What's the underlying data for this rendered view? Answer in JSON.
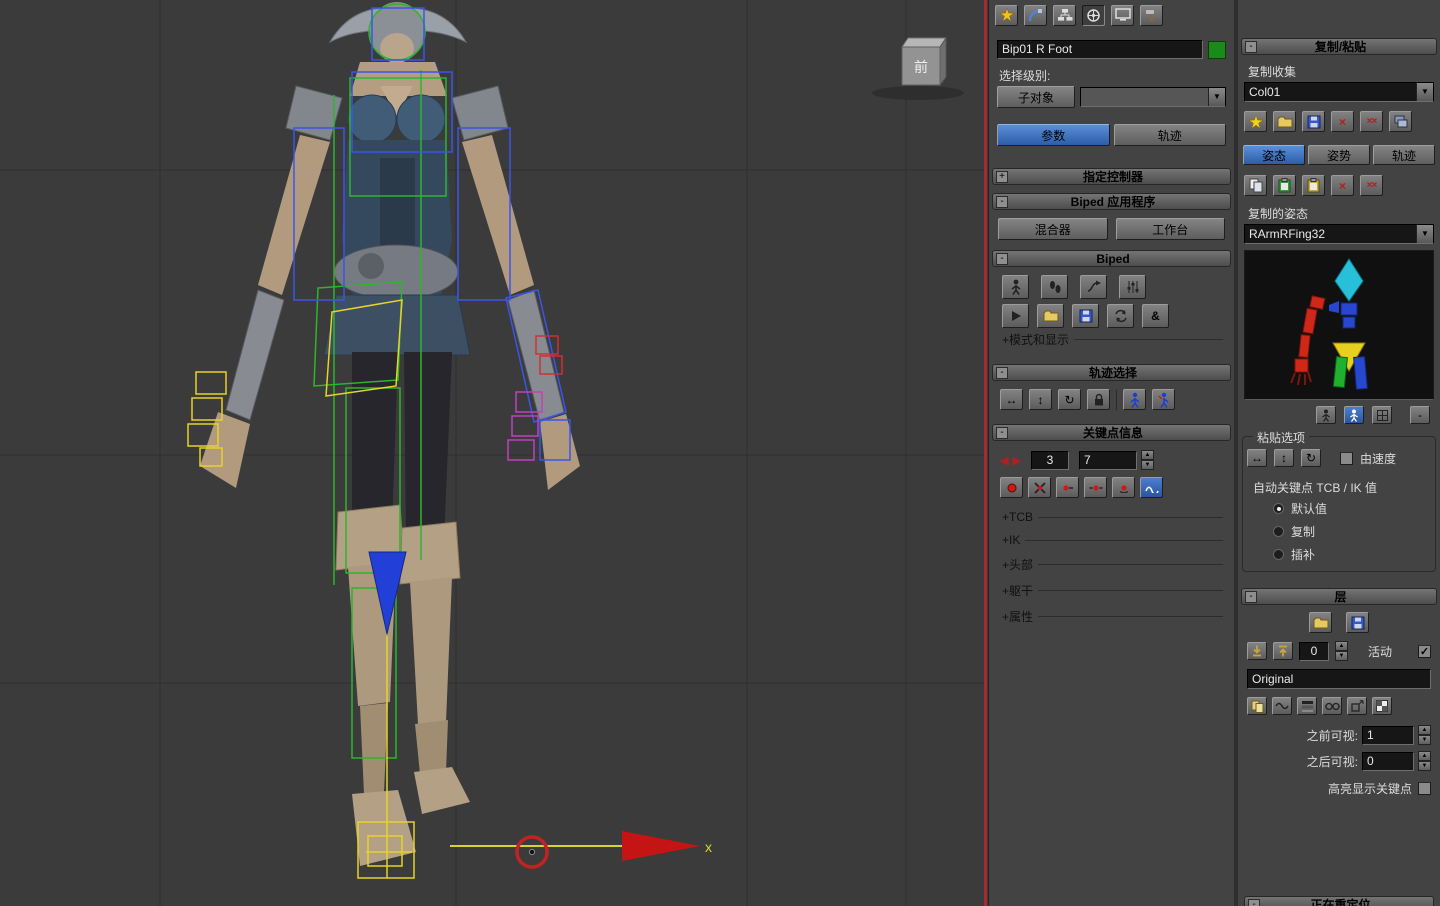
{
  "icons": {
    "plus": "+",
    "minus": "-",
    "prev": "◀",
    "next": "▶",
    "h_arrows": "↔",
    "v_arrows": "↕",
    "rotate": "↻",
    "cross": "×",
    "double_cross": "××",
    "check": "✓",
    "amp": "&",
    "spin_up": "▲",
    "spin_down": "▼"
  },
  "viewport": {
    "viewcube_label": "前",
    "axis_label": "x"
  },
  "motion_panel": {
    "object_name": "Bip01 R Foot",
    "selection_level_label": "选择级别:",
    "subobject_button": "子对象",
    "tab_parameters": "参数",
    "tab_trajectories": "轨迹",
    "assign_controller_title": "指定控制器",
    "biped_apps_title": "Biped 应用程序",
    "mixer_button": "混合器",
    "workbench_button": "工作台",
    "biped_title": "Biped",
    "modes_display_expander": "+模式和显示",
    "track_selection_title": "轨迹选择",
    "key_info_title": "关键点信息",
    "key_number": "3",
    "frame_number": "7",
    "expanders": {
      "tcb": "+TCB",
      "ik": "+IK",
      "head": "+头部",
      "body": "+躯干",
      "prop": "+属性"
    }
  },
  "copy_paste_panel": {
    "title": "复制/粘贴",
    "collections_label": "复制收集",
    "collection_value": "Col01",
    "tab_posture": "姿态",
    "tab_pose": "姿势",
    "tab_track": "轨迹",
    "copied_postures_label": "复制的姿态",
    "copied_posture_value": "RArmRFing32",
    "paste_options_label": "粘贴选项",
    "by_velocity_label": "由速度",
    "autokey_label": "自动关键点 TCB / IK 值",
    "radio_default": "默认值",
    "radio_copied": "复制",
    "radio_interp": "插补",
    "layers_title": "层",
    "layer_index": "0",
    "active_label": "活动",
    "layer_name": "Original",
    "visible_before_label": "之前可视:",
    "visible_before_value": "1",
    "visible_after_label": "之后可视:",
    "visible_after_value": "0",
    "highlight_keys_label": "高亮显示关键点",
    "retarget_title": "正在重定位"
  }
}
